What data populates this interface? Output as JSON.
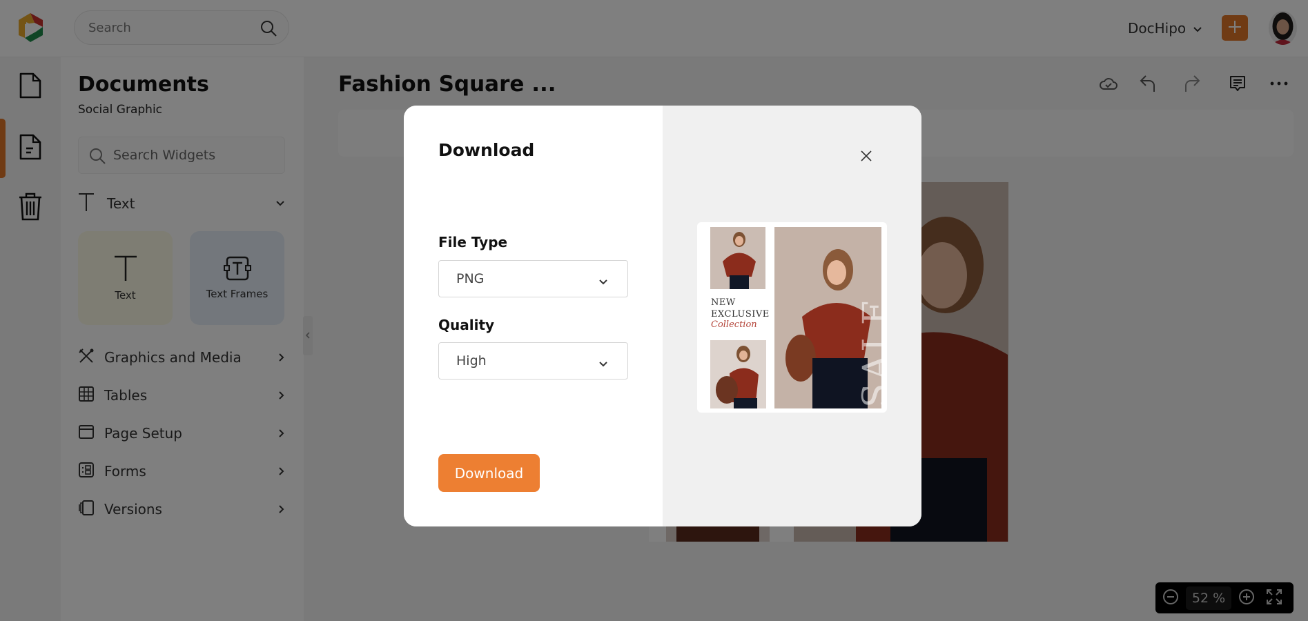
{
  "app": {
    "brand_colors": {
      "accent": "#e07628",
      "button": "#ed7f32",
      "logo_red": "#c9302c",
      "logo_yellow": "#e8a92a",
      "logo_green": "#1e8a4a"
    }
  },
  "topbar": {
    "search_placeholder": "Search",
    "workspace_label": "DocHipo",
    "add_icon": "plus-icon",
    "search_icon": "search-icon"
  },
  "rail": {
    "items": [
      {
        "name": "new-document",
        "icon": "document-icon",
        "active": false
      },
      {
        "name": "documents",
        "icon": "document-text-icon",
        "active": true
      },
      {
        "name": "trash",
        "icon": "trash-icon",
        "active": false
      }
    ]
  },
  "panel": {
    "title": "Documents",
    "subtitle": "Social Graphic",
    "search_placeholder": "Search Widgets",
    "text_section": {
      "label": "Text",
      "cards": [
        {
          "label": "Text",
          "icon": "text-icon"
        },
        {
          "label": "Text Frames",
          "icon": "text-frame-icon"
        }
      ]
    },
    "menu": [
      {
        "label": "Graphics and Media",
        "icon": "graphics-media-icon"
      },
      {
        "label": "Tables",
        "icon": "table-icon"
      },
      {
        "label": "Page Setup",
        "icon": "page-setup-icon"
      },
      {
        "label": "Forms",
        "icon": "forms-icon"
      },
      {
        "label": "Versions",
        "icon": "versions-icon"
      }
    ]
  },
  "editor": {
    "doc_title": "Fashion Square ...",
    "toolbar": [
      "cloud-saved-icon",
      "undo-icon",
      "redo-icon",
      "comment-icon",
      "more-icon"
    ],
    "zoom": {
      "value": "52",
      "unit": "%"
    }
  },
  "modal": {
    "title": "Download",
    "file_type_label": "File Type",
    "file_type_value": "PNG",
    "quality_label": "Quality",
    "quality_value": "High",
    "download_label": "Download",
    "preview": {
      "line1": "NEW",
      "line2": "EXCLUSIVE",
      "line3": "Collection",
      "sale": "SALE"
    }
  }
}
